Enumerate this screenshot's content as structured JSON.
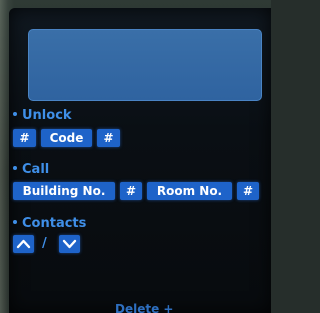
{
  "display": {
    "text": ""
  },
  "unlock": {
    "label": "Unlock",
    "keys": [
      "#",
      "Code",
      "#"
    ]
  },
  "call": {
    "label": "Call",
    "keys": [
      "Building No.",
      "#",
      "Room No.",
      "#"
    ]
  },
  "contacts": {
    "label": "Contacts",
    "separator": "/",
    "up_icon": "chevron-up-icon",
    "down_icon": "chevron-down-icon"
  },
  "footer": {
    "label": "Delete +"
  },
  "colors": {
    "label_blue": "#3f8fe8",
    "key_blue": "#1e63c9",
    "display_blue": "#3a6fa8",
    "screen_bg": "#0a0f14"
  }
}
